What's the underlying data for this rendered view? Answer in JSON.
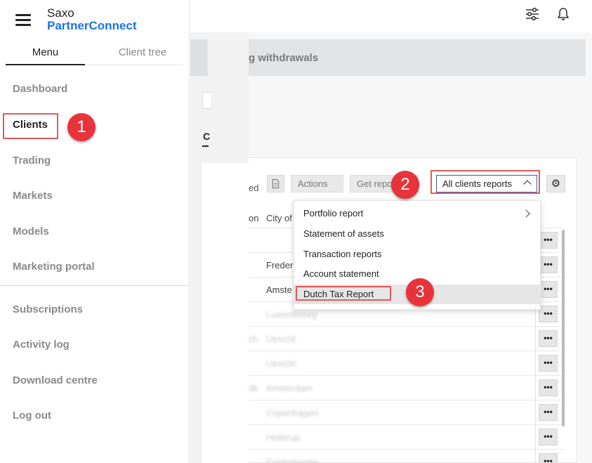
{
  "brand": {
    "line1": "Saxo",
    "line2": "PartnerConnect"
  },
  "sidebar": {
    "tabs": [
      {
        "label": "Menu"
      },
      {
        "label": "Client tree"
      }
    ],
    "items": [
      {
        "label": "Dashboard"
      },
      {
        "label": "Clients"
      },
      {
        "label": "Trading"
      },
      {
        "label": "Markets"
      },
      {
        "label": "Models"
      },
      {
        "label": "Marketing portal"
      },
      {
        "label": "Subscriptions"
      },
      {
        "label": "Activity log"
      },
      {
        "label": "Download centre"
      },
      {
        "label": "Log out"
      }
    ]
  },
  "header": {
    "banner_title": "g withdrawals"
  },
  "main": {
    "left_tab_fragment": "C",
    "toolbar": {
      "fragment_text": "ed",
      "actions_label": "Actions",
      "get_reports_label": "Get repo",
      "all_clients_reports_label": "All clients reports"
    },
    "table": {
      "headers": [
        "on",
        "City of"
      ],
      "action_label": "•••",
      "rows": [
        {
          "lead": "",
          "city": ""
        },
        {
          "lead": "",
          "city": "Freder"
        },
        {
          "lead": "",
          "city": "Amste"
        },
        {
          "lead": "",
          "city": "Luxembourg"
        },
        {
          "lead": "ch",
          "city": "Utrecht"
        },
        {
          "lead": "",
          "city": "Utrecht"
        },
        {
          "lead": "dk",
          "city": "Amsterdam"
        },
        {
          "lead": "",
          "city": "Copenhagen"
        },
        {
          "lead": "",
          "city": "Hellerup"
        },
        {
          "lead": "",
          "city": "Copenhagen"
        }
      ]
    }
  },
  "dropdown": {
    "items": [
      {
        "label": "Portfolio report"
      },
      {
        "label": "Statement of assets"
      },
      {
        "label": "Transaction reports"
      },
      {
        "label": "Account statement"
      },
      {
        "label": "Dutch Tax Report"
      }
    ]
  },
  "annotations": {
    "badge1": "1",
    "badge2": "2",
    "badge3": "3"
  },
  "colors": {
    "brand_blue": "#1a73e8",
    "badge_red": "#e8333a",
    "highlight_red": "#e35a5a"
  }
}
